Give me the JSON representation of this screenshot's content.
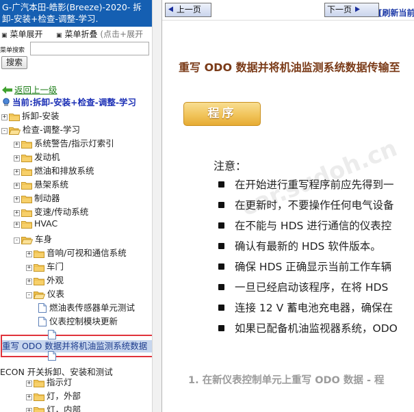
{
  "left_pane": {
    "app_title": "G-广汽本田-皓影(Breeze)-2020- 拆卸-安装+检查-调整-学习.",
    "menu_expand_label": "菜单展开",
    "menu_collapse_label": "菜单折叠",
    "menu_collapse_hint": "(点击+展开",
    "search_label": "菜单搜索",
    "search_value": "",
    "search_button": "搜索",
    "back_link": "返回上一级",
    "current_path": "当前:拆卸-安装+检查-调整-学习",
    "tree": [
      {
        "label": "拆卸-安装",
        "toggle": "+"
      },
      {
        "label": "检查-调整-学习",
        "toggle": "-"
      },
      {
        "label": "系统警告/指示灯索引",
        "toggle": "+"
      },
      {
        "label": "发动机",
        "toggle": "+"
      },
      {
        "label": "燃油和排放系统",
        "toggle": "+"
      },
      {
        "label": "悬架系统",
        "toggle": "+"
      },
      {
        "label": "制动器",
        "toggle": "+"
      },
      {
        "label": "变速/传动系统",
        "toggle": "+"
      },
      {
        "label": "HVAC",
        "toggle": "+"
      },
      {
        "label": "车身",
        "toggle": "-"
      },
      {
        "label": "音响/可视和通信系统",
        "toggle": "+"
      },
      {
        "label": "车门",
        "toggle": "+"
      },
      {
        "label": "外观",
        "toggle": "+"
      },
      {
        "label": "仪表",
        "toggle": "-"
      },
      {
        "label": "燃油表传感器单元测试",
        "toggle": ""
      },
      {
        "label": "仪表控制模块更新",
        "toggle": ""
      }
    ],
    "selected_item": "重写 ODO 数据并将机油监测系统数据",
    "tree_after": [
      {
        "label": "ECON 开关拆卸、安装和测试",
        "toggle": ""
      },
      {
        "label": "指示灯",
        "toggle": "+"
      },
      {
        "label": "灯，外部",
        "toggle": "+"
      },
      {
        "label": "灯，内部",
        "toggle": "+"
      }
    ]
  },
  "right_pane": {
    "prev_button": "上一页",
    "next_button": "下一页",
    "refresh_link": "[刷新当前",
    "doc_title": "重写 ODO 数据并将机油监测系统数据传输至",
    "procedure_button": "程序",
    "note_title": "注意：",
    "notes": [
      "在开始进行重写程序前应先得到一",
      "在更新时，不要操作任何电气设备",
      "在不能与 HDS 进行通信的仪表控",
      "确认有最新的 HDS 软件版本。",
      "确保 HDS 正确显示当前工作车辆",
      "一旦已经启动该程序，在将 HDS",
      "连接 12 V 蓄电池充电器，确保在",
      "如果已配备机油监视器系统，ODO"
    ],
    "step_heading": "1. 在新仪表控制单元上重写 ODO 数据 - 程"
  },
  "colors": {
    "title_bar": "#155fb2",
    "selected_border": "#e0323a",
    "doc_title": "#7a3a17",
    "procedure_button": "#f1c45a",
    "link_blue": "#1b2fb5",
    "back_green": "#1c7d17"
  }
}
